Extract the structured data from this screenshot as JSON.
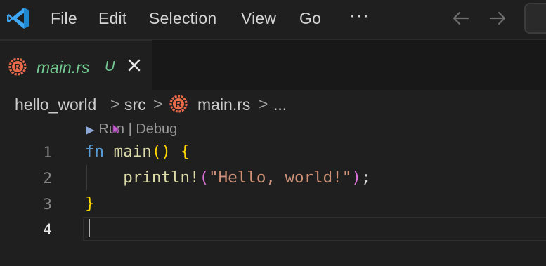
{
  "menu": {
    "items": [
      "File",
      "Edit",
      "Selection",
      "View",
      "Go"
    ],
    "more": "···"
  },
  "tab": {
    "filename": "main.rs",
    "status": "U"
  },
  "breadcrumb": {
    "project": "hello_world",
    "folder": "src",
    "file": "main.rs",
    "ellipsis": "...",
    "separator": ">"
  },
  "editor": {
    "codelens": {
      "run": "Run",
      "separator": "|",
      "debug": "Debug"
    },
    "line_numbers": [
      "1",
      "2",
      "3",
      "4"
    ],
    "active_line": 4,
    "lines": [
      [
        {
          "text": "fn",
          "kind": "kw"
        },
        {
          "text": " ",
          "kind": "plain"
        },
        {
          "text": "main",
          "kind": "fn"
        },
        {
          "text": "()",
          "kind": "p1"
        },
        {
          "text": " ",
          "kind": "plain"
        },
        {
          "text": "{",
          "kind": "p1"
        }
      ],
      [
        {
          "text": "    ",
          "kind": "plain"
        },
        {
          "text": "println!",
          "kind": "fn"
        },
        {
          "text": "(",
          "kind": "p2"
        },
        {
          "text": "\"Hello, world!\"",
          "kind": "str"
        },
        {
          "text": ")",
          "kind": "p2"
        },
        {
          "text": ";",
          "kind": "plain"
        }
      ],
      [
        {
          "text": "}",
          "kind": "p1"
        }
      ],
      []
    ]
  },
  "colors": {
    "accent_untracked": "#73c991",
    "rust_icon": "#e8694a",
    "vscode_blue": "#3ea8f5"
  },
  "icons": {
    "logo": "vscode-logo-icon",
    "tab_file": "rust-file-icon",
    "close": "close-icon",
    "back": "arrow-left-icon",
    "forward": "arrow-right-icon",
    "run": "play-icon"
  }
}
